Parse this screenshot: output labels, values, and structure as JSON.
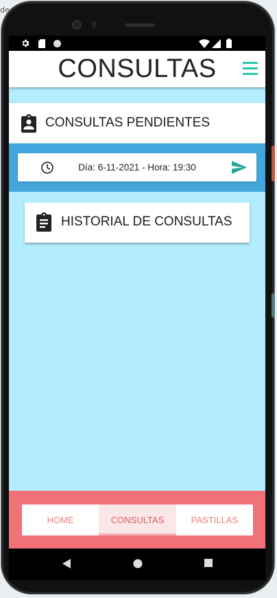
{
  "corner_text": "de",
  "app_bar": {
    "title": "CONSULTAS",
    "menu_icon": "menu-icon"
  },
  "pending": {
    "header_label": "CONSULTAS PENDIENTES",
    "item_text": "Día: 6-11-2021 - Hora: 19:30"
  },
  "history": {
    "label": "HISTORIAL DE CONSULTAS"
  },
  "bottom_tabs": {
    "items": [
      {
        "label": "HOME",
        "active": false
      },
      {
        "label": "CONSULTAS",
        "active": true
      },
      {
        "label": "PASTILLAS",
        "active": false
      }
    ]
  },
  "colors": {
    "screen_bg": "#b3ecfc",
    "accent_teal": "#26c5b3",
    "pending_band": "#42a5db",
    "bottom_bar": "#f07178",
    "tab_text": "#ec7a82"
  },
  "icons": {
    "status": [
      "settings-icon",
      "sd-card-icon",
      "circle-icon",
      "wifi-icon",
      "signal-icon",
      "battery-icon"
    ],
    "nav": [
      "back-icon",
      "home-icon",
      "recents-icon"
    ]
  }
}
